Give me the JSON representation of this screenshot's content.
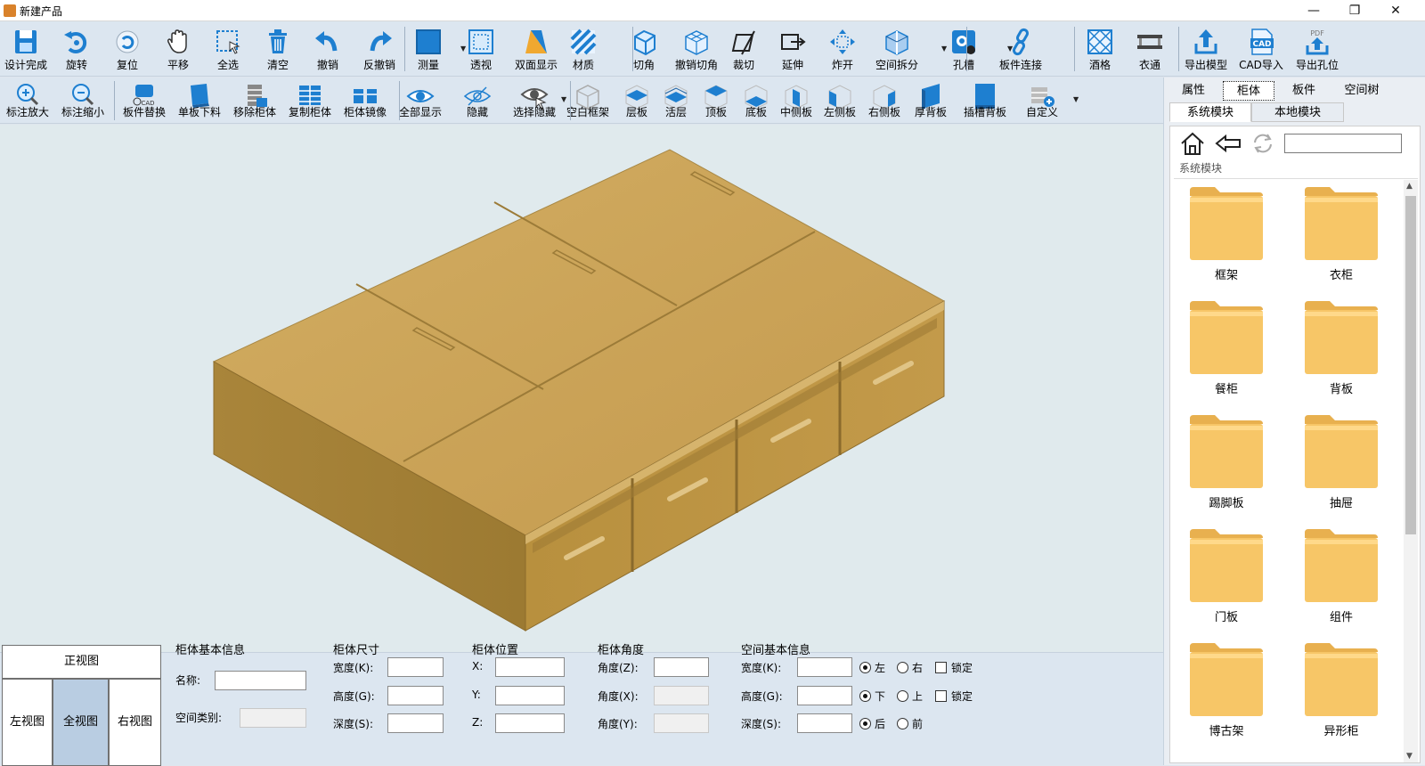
{
  "window": {
    "title": "新建产品",
    "minimize": "—",
    "maximize": "❐",
    "close": "✕"
  },
  "toolbar1": [
    {
      "id": "design-done",
      "label": "设计完成",
      "icon": "save-icon"
    },
    {
      "id": "rotate",
      "label": "旋转",
      "icon": "rotate-icon"
    },
    {
      "id": "reset",
      "label": "复位",
      "icon": "reset-icon"
    },
    {
      "id": "pan",
      "label": "平移",
      "icon": "hand-icon"
    },
    {
      "id": "select-all",
      "label": "全选",
      "icon": "select-all-icon"
    },
    {
      "id": "clear",
      "label": "清空",
      "icon": "trash-icon"
    },
    {
      "id": "undo",
      "label": "撤销",
      "icon": "undo-icon"
    },
    {
      "id": "redo",
      "label": "反撤销",
      "icon": "redo-icon"
    },
    {
      "id": "measure",
      "label": "测量",
      "icon": "measure-icon"
    },
    {
      "id": "perspective",
      "label": "透视",
      "icon": "perspective-icon"
    },
    {
      "id": "double-side",
      "label": "双面显示",
      "icon": "double-side-icon"
    },
    {
      "id": "material",
      "label": "材质",
      "icon": "material-icon"
    },
    {
      "id": "cut-corner",
      "label": "切角",
      "icon": "cut-corner-icon"
    },
    {
      "id": "undo-cut-corner",
      "label": "撤销切角",
      "icon": "undo-cut-corner-icon"
    },
    {
      "id": "trim",
      "label": "裁切",
      "icon": "trim-icon"
    },
    {
      "id": "extend",
      "label": "延伸",
      "icon": "extend-icon"
    },
    {
      "id": "explode",
      "label": "炸开",
      "icon": "explode-icon"
    },
    {
      "id": "space-split",
      "label": "空间拆分",
      "icon": "space-split-icon"
    },
    {
      "id": "hole-slot",
      "label": "孔槽",
      "icon": "hole-slot-icon"
    },
    {
      "id": "panel-connect",
      "label": "板件连接",
      "icon": "link-icon"
    },
    {
      "id": "wine-rack",
      "label": "酒格",
      "icon": "wine-rack-icon"
    },
    {
      "id": "wardrobe-rail",
      "label": "衣通",
      "icon": "rail-icon"
    },
    {
      "id": "export-model",
      "label": "导出模型",
      "icon": "export-icon"
    },
    {
      "id": "cad-import",
      "label": "CAD导入",
      "icon": "cad-icon"
    },
    {
      "id": "export-holes",
      "label": "导出孔位",
      "icon": "pdf-export-icon"
    }
  ],
  "toolbar2": [
    {
      "id": "zoom-in-label",
      "label": "标注放大",
      "icon": "zoom-in-icon"
    },
    {
      "id": "zoom-out-label",
      "label": "标注缩小",
      "icon": "zoom-out-icon"
    },
    {
      "id": "panel-replace",
      "label": "板件替换",
      "icon": "cad-replace-icon"
    },
    {
      "id": "single-board",
      "label": "单板下料",
      "icon": "board-icon"
    },
    {
      "id": "remove-cabinet",
      "label": "移除柜体",
      "icon": "remove-cabinet-icon"
    },
    {
      "id": "copy-cabinet",
      "label": "复制柜体",
      "icon": "copy-cabinet-icon"
    },
    {
      "id": "mirror-cabinet",
      "label": "柜体镜像",
      "icon": "mirror-icon"
    },
    {
      "id": "show-all",
      "label": "全部显示",
      "icon": "eye-icon"
    },
    {
      "id": "hide",
      "label": "隐藏",
      "icon": "eye-hidden-icon"
    },
    {
      "id": "select-hide",
      "label": "选择隐藏",
      "icon": "select-hide-icon"
    },
    {
      "id": "empty-frame",
      "label": "空白框架",
      "icon": "frame-icon"
    },
    {
      "id": "shelf",
      "label": "层板",
      "icon": "shelf-icon"
    },
    {
      "id": "movable-shelf",
      "label": "活层",
      "icon": "movable-shelf-icon"
    },
    {
      "id": "top-board",
      "label": "顶板",
      "icon": "top-board-icon"
    },
    {
      "id": "bottom-board",
      "label": "底板",
      "icon": "bottom-board-icon"
    },
    {
      "id": "middle-side",
      "label": "中侧板",
      "icon": "middle-side-icon"
    },
    {
      "id": "left-side",
      "label": "左侧板",
      "icon": "left-side-icon"
    },
    {
      "id": "right-side",
      "label": "右侧板",
      "icon": "right-side-icon"
    },
    {
      "id": "thick-back",
      "label": "厚背板",
      "icon": "thick-back-icon"
    },
    {
      "id": "slot-back",
      "label": "插槽背板",
      "icon": "slot-back-icon"
    },
    {
      "id": "custom",
      "label": "自定义",
      "icon": "custom-icon"
    }
  ],
  "views": {
    "front": "正视图",
    "left": "左视图",
    "full": "全视图",
    "right": "右视图"
  },
  "basic_info": {
    "title": "柜体基本信息",
    "name_label": "名称:",
    "name_value": "",
    "type_label": "空间类别:",
    "type_value": ""
  },
  "size": {
    "title": "柜体尺寸",
    "width_label": "宽度(K):",
    "height_label": "高度(G):",
    "depth_label": "深度(S):",
    "width": "",
    "height": "",
    "depth": ""
  },
  "position": {
    "title": "柜体位置",
    "x_label": "X:",
    "y_label": "Y:",
    "z_label": "Z:",
    "x": "",
    "y": "",
    "z": ""
  },
  "angle": {
    "title": "柜体角度",
    "z_label": "角度(Z):",
    "x_label": "角度(X):",
    "y_label": "角度(Y):",
    "z": "",
    "x": "",
    "y": ""
  },
  "space": {
    "title": "空间基本信息",
    "width_label": "宽度(K):",
    "height_label": "高度(G):",
    "depth_label": "深度(S):",
    "width": "",
    "height": "",
    "depth": "",
    "left": "左",
    "right": "右",
    "lock1": "锁定",
    "down": "下",
    "up": "上",
    "lock2": "锁定",
    "back": "后",
    "front": "前"
  },
  "right_panel": {
    "tabs": [
      "属性",
      "柜体",
      "板件",
      "空间树"
    ],
    "active_tab": "柜体",
    "subtabs": [
      "系统模块",
      "本地模块"
    ],
    "active_subtab": "系统模块",
    "search_value": "",
    "breadcrumb": "系统模块",
    "folders": [
      "框架",
      "衣柜",
      "餐柜",
      "背板",
      "踢脚板",
      "抽屉",
      "门板",
      "组件",
      "博古架",
      "异形柜"
    ]
  },
  "colors": {
    "toolbar_bg": "#dce6f0",
    "icon_blue": "#1e7fd0",
    "wood_top": "#c9a55a",
    "wood_front": "#b08a3c",
    "folder": "#f7c667"
  }
}
